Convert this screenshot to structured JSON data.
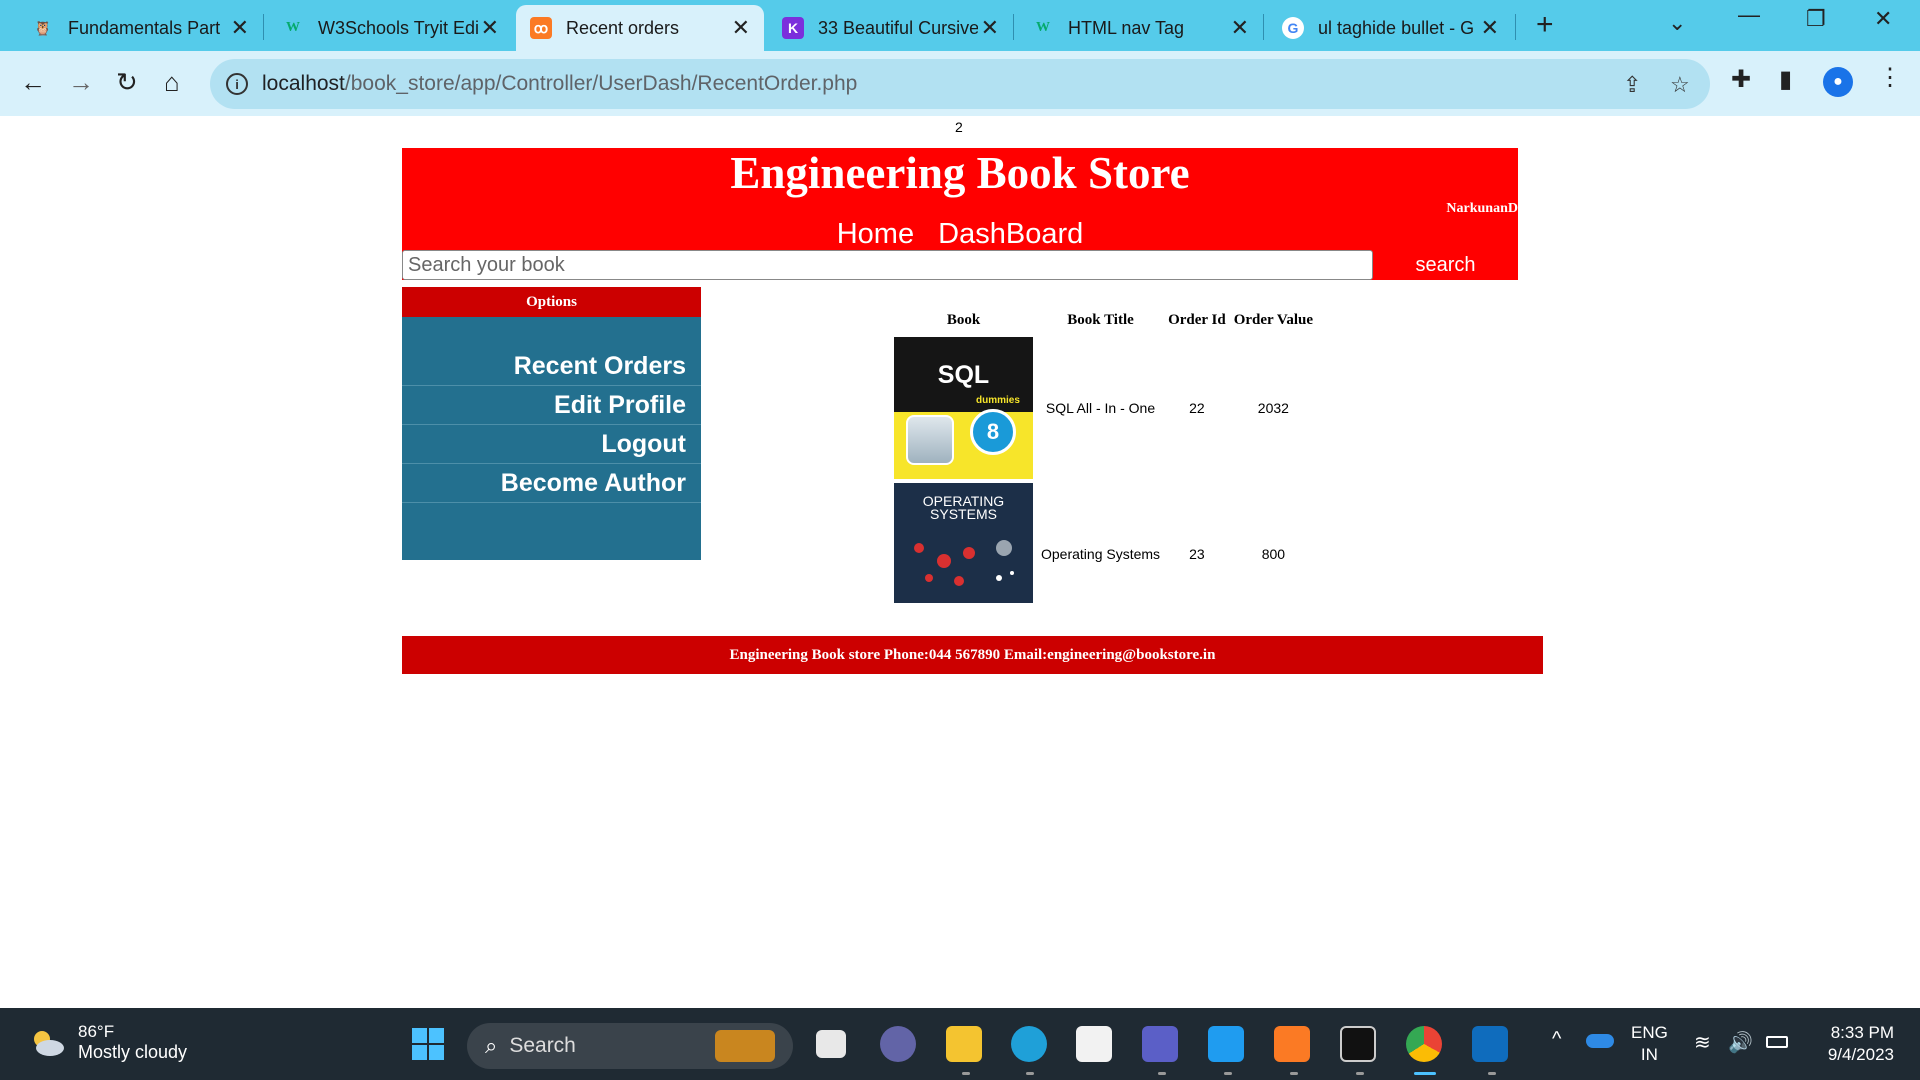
{
  "browser": {
    "tabs": [
      {
        "title": "Fundamentals Part",
        "favicon": "owl-icon",
        "color": "#f3a93c"
      },
      {
        "title": "W3Schools Tryit Edi",
        "favicon": "w3schools-icon",
        "color": "#04aa6d"
      },
      {
        "title": "Recent orders",
        "favicon": "xampp-icon",
        "color": "#fb7a24"
      },
      {
        "title": "33 Beautiful Cursive",
        "favicon": "k-icon",
        "color": "#7b2fdc"
      },
      {
        "title": "HTML nav Tag",
        "favicon": "w3schools-icon",
        "color": "#04aa6d"
      },
      {
        "title": "ul taghide bullet - G",
        "favicon": "google-icon",
        "color": "#4285f4"
      }
    ],
    "active_tab": 2,
    "url_host": "localhost",
    "url_path": "/book_store/app/Controller/UserDash/RecentOrder.php"
  },
  "page": {
    "counter": "2",
    "site_title": "Engineering Book Store",
    "username": "NarkunanD",
    "nav": [
      "Home",
      "DashBoard"
    ],
    "search_placeholder": "Search your book",
    "search_button": "search",
    "sidebar": {
      "heading": "Options",
      "items": [
        "Recent Orders",
        "Edit Profile",
        "Logout",
        "Become Author"
      ]
    },
    "orders": {
      "headers": [
        "Book",
        "Book Title",
        "Order Id",
        "Order Value"
      ],
      "rows": [
        {
          "cover": "SQL All-In-One For Dummies cover",
          "cover_text": "SQL",
          "title": "SQL All - In - One",
          "order_id": "22",
          "order_value": "2032"
        },
        {
          "cover": "Operating Systems cover",
          "cover_text": "OPERATING SYSTEMS",
          "title": "Operating Systems",
          "order_id": "23",
          "order_value": "800"
        }
      ]
    },
    "footer": "Engineering Book store Phone:044 567890 Email:engineering@bookstore.in"
  },
  "taskbar": {
    "weather_temp": "86°F",
    "weather_cond": "Mostly cloudy",
    "search_label": "Search",
    "lang_line1": "ENG",
    "lang_line2": "IN",
    "time": "8:33 PM",
    "date": "9/4/2023"
  },
  "colors": {
    "header_red": "#ff0000",
    "dark_red": "#cc0000",
    "sidebar_blue": "#23708f",
    "chrome_cyan": "#55cbea"
  }
}
